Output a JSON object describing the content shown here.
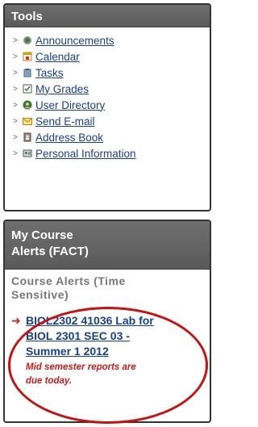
{
  "tools": {
    "title": "Tools",
    "items": [
      {
        "label": "Announcements",
        "icon": "announcements-icon"
      },
      {
        "label": "Calendar",
        "icon": "calendar-icon"
      },
      {
        "label": "Tasks",
        "icon": "tasks-icon"
      },
      {
        "label": "My Grades",
        "icon": "grades-icon"
      },
      {
        "label": "User Directory",
        "icon": "user-directory-icon"
      },
      {
        "label": "Send E-mail",
        "icon": "email-icon"
      },
      {
        "label": "Address Book",
        "icon": "address-book-icon"
      },
      {
        "label": "Personal Information",
        "icon": "personal-info-icon"
      }
    ]
  },
  "alerts": {
    "title_line1": "My Course",
    "title_line2": "Alerts (FACT)",
    "subhead_line1": "Course Alerts (Time",
    "subhead_line2": "Sensitive)",
    "alert_link_line1": "BIOL2302 41036 Lab for",
    "alert_link_line2": "BIOL 2301 SEC 03 -",
    "alert_link_line3": "Summer 1 2012",
    "alert_note_line1": "Mid semester reports are",
    "alert_note_line2": "due today."
  },
  "colors": {
    "header_bg": "#5f5f5f",
    "link": "#1a3d99",
    "alert_red": "#d01919",
    "highlight": "#cc1010"
  }
}
